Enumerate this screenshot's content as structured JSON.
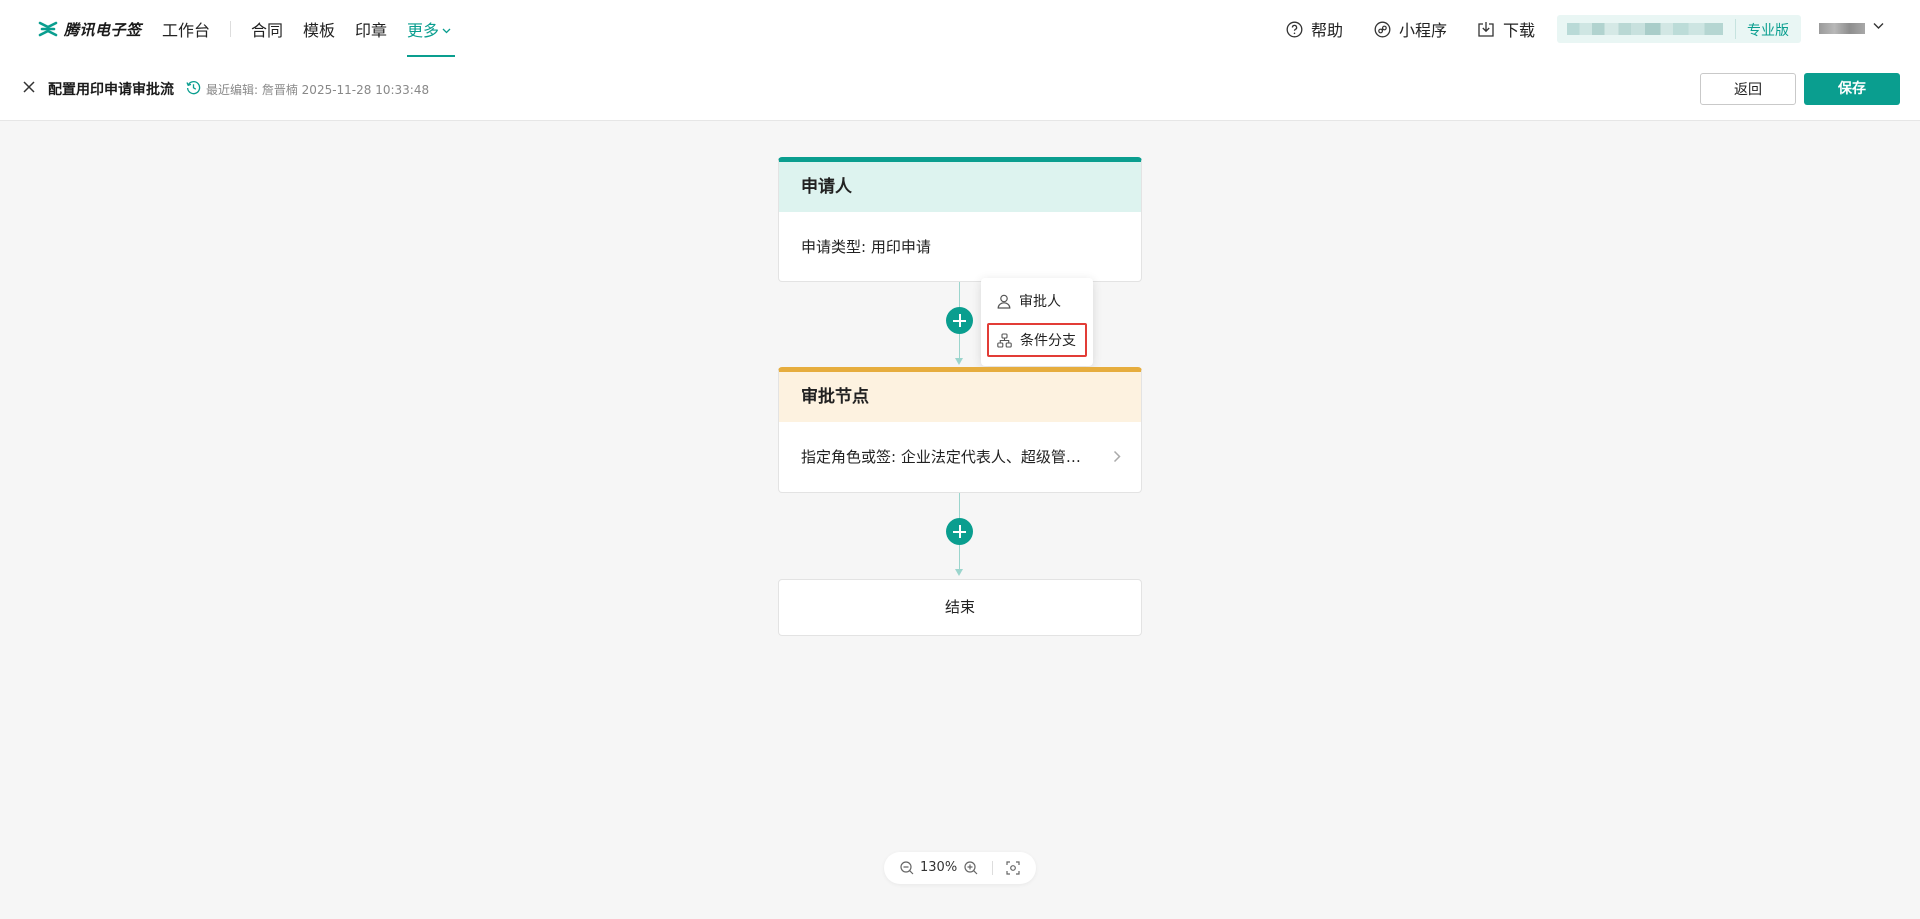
{
  "topnav": {
    "logo_text": "腾讯电子签",
    "items": [
      {
        "label": "工作台"
      },
      {
        "label": "合同"
      },
      {
        "label": "模板"
      },
      {
        "label": "印章"
      },
      {
        "label": "更多"
      }
    ],
    "tools": {
      "help": "帮助",
      "mini_program": "小程序",
      "download": "下载"
    },
    "org_plan": "专业版"
  },
  "subheader": {
    "title": "配置用印申请审批流",
    "last_edit": "最近编辑: 詹晋楠 2025-11-28 10:33:48",
    "back_label": "返回",
    "save_label": "保存"
  },
  "flow": {
    "applicant": {
      "title": "申请人",
      "desc": "申请类型: 用印申请"
    },
    "approval": {
      "title": "审批节点",
      "desc": "指定角色或签: 企业法定代表人、超级管…"
    },
    "end_label": "结束"
  },
  "add_menu": {
    "items": [
      {
        "label": "审批人",
        "icon": "user-icon"
      },
      {
        "label": "条件分支",
        "icon": "branch-icon"
      }
    ],
    "highlighted": "条件分支"
  },
  "zoom": {
    "level": "130%"
  },
  "colors": {
    "brand": "#0a9e8f",
    "applicant_header": "#ddf3ef",
    "approval_accent": "#e6ad3e",
    "approval_header": "#fdf2e0",
    "highlight_border": "#e23c36"
  }
}
